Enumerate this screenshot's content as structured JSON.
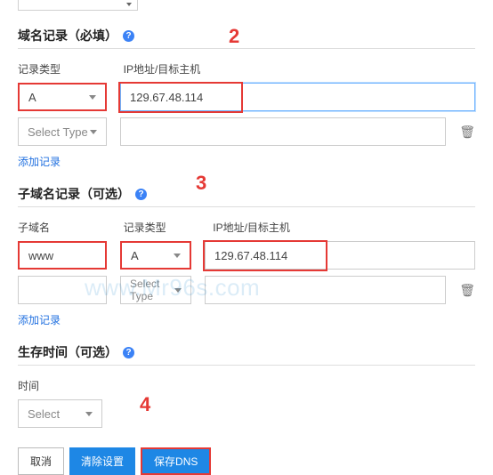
{
  "topSelectChev": "",
  "sections": {
    "domain": {
      "title": "域名记录（必填）",
      "recordTypeLabel": "记录类型",
      "ipLabel": "IP地址/目标主机",
      "row1": {
        "type": "A",
        "ip": "129.67.48.114"
      },
      "row2": {
        "type": "Select Type",
        "ip": ""
      },
      "addLink": "添加记录"
    },
    "subdomain": {
      "title": "子域名记录（可选）",
      "subLabel": "子域名",
      "recordTypeLabel": "记录类型",
      "ipLabel": "IP地址/目标主机",
      "row1": {
        "sub": "www",
        "type": "A",
        "ip": "129.67.48.114"
      },
      "row2": {
        "sub": "",
        "type": "Select Type",
        "ip": ""
      },
      "addLink": "添加记录"
    },
    "ttl": {
      "title": "生存时间（可选）",
      "timeLabel": "时间",
      "select": "Select"
    }
  },
  "buttons": {
    "cancel": "取消",
    "clear": "清除设置",
    "save": "保存DNS"
  },
  "callouts": {
    "c2": "2",
    "c3": "3",
    "c4": "4"
  },
  "watermark": "www.Mr96s.com",
  "icons": {
    "help": "?",
    "trash": "🗑"
  }
}
